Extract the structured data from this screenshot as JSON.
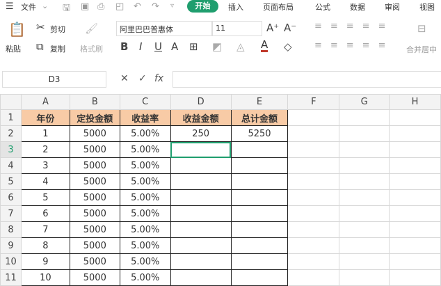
{
  "menubar": {
    "file": "文件",
    "start": "开始",
    "tabs": [
      "插入",
      "页面布局",
      "公式",
      "数据",
      "审阅",
      "视图"
    ]
  },
  "ribbon": {
    "paste": "粘贴",
    "cut": "剪切",
    "copy": "复制",
    "format_painter": "格式刷",
    "font": "阿里巴巴普惠体",
    "size": "11",
    "merge": "合并居中"
  },
  "formula_bar": {
    "name_box": "D3",
    "fx": "fx",
    "value": ""
  },
  "grid": {
    "columns": [
      "A",
      "B",
      "C",
      "D",
      "E",
      "F",
      "G",
      "H"
    ],
    "selected_cell": "D3",
    "rows": [
      [
        "年份",
        "定投金额",
        "收益率",
        "收益金额",
        "总计金额",
        "",
        "",
        ""
      ],
      [
        "1",
        "5000",
        "5.00%",
        "250",
        "5250",
        "",
        "",
        ""
      ],
      [
        "2",
        "5000",
        "5.00%",
        "",
        "",
        "",
        "",
        ""
      ],
      [
        "3",
        "5000",
        "5.00%",
        "",
        "",
        "",
        "",
        ""
      ],
      [
        "4",
        "5000",
        "5.00%",
        "",
        "",
        "",
        "",
        ""
      ],
      [
        "5",
        "5000",
        "5.00%",
        "",
        "",
        "",
        "",
        ""
      ],
      [
        "6",
        "5000",
        "5.00%",
        "",
        "",
        "",
        "",
        ""
      ],
      [
        "7",
        "5000",
        "5.00%",
        "",
        "",
        "",
        "",
        ""
      ],
      [
        "8",
        "5000",
        "5.00%",
        "",
        "",
        "",
        "",
        ""
      ],
      [
        "9",
        "5000",
        "5.00%",
        "",
        "",
        "",
        "",
        ""
      ],
      [
        "10",
        "5000",
        "5.00%",
        "",
        "",
        "",
        "",
        ""
      ]
    ]
  },
  "colors": {
    "accent": "#1f9e6e",
    "header_fill": "#f8cba6"
  }
}
